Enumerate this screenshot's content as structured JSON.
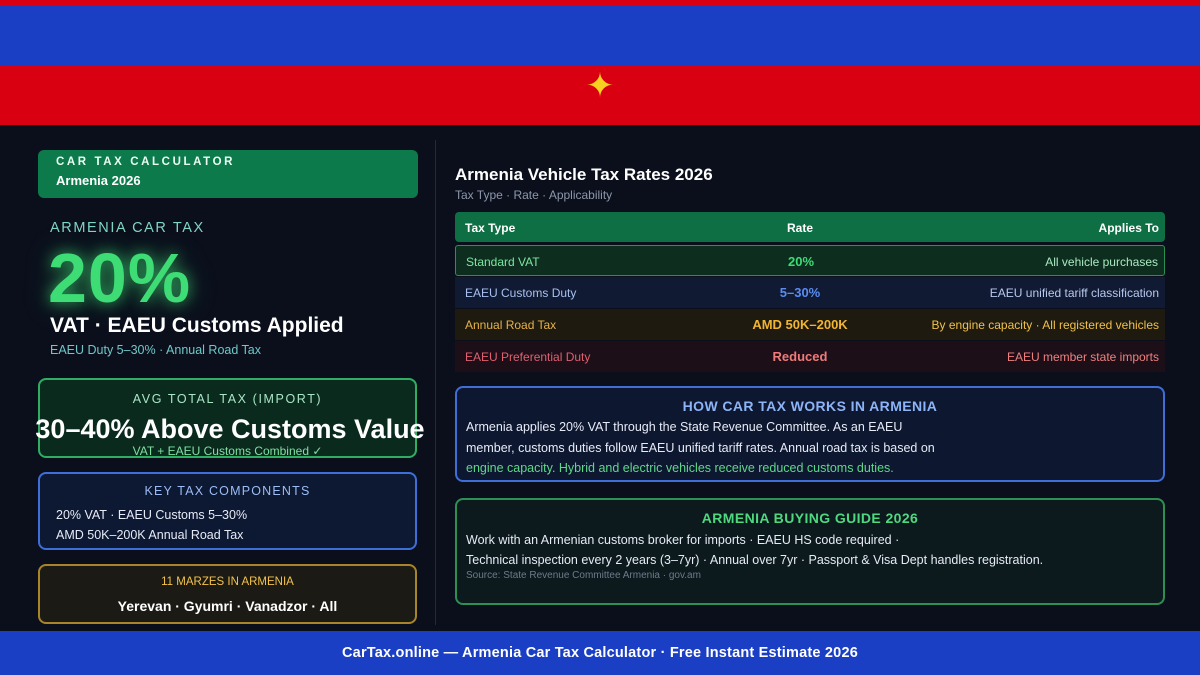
{
  "colors": {
    "flag_red": "#d90012",
    "flag_blue": "#1a3ec4",
    "flag_star": "#f8d020",
    "background": "#0b0f1c",
    "accent_green": "#3ddc74",
    "accent_blue": "#3e6ed8",
    "accent_gold": "#f2b531",
    "accent_red": "#f07a7a"
  },
  "flag": {
    "star_icon": "four-point-star-icon",
    "star_glyph": "✦"
  },
  "badge": {
    "title": "CAR TAX CALCULATOR",
    "subtitle": "Armenia 2026"
  },
  "hero": {
    "label": "ARMENIA CAR TAX",
    "rate": "20%",
    "headline": "VAT · EAEU Customs Applied",
    "sub": "EAEU Duty 5–30% · Annual Road Tax"
  },
  "avg_tax": {
    "label": "AVG TOTAL TAX (IMPORT)",
    "value": "30–40% Above Customs Value",
    "note": "VAT + EAEU Customs Combined ✓"
  },
  "key_components": {
    "label": "KEY TAX COMPONENTS",
    "line1": "20% VAT · EAEU Customs 5–30%",
    "line2": "AMD 50K–200K Annual Road Tax"
  },
  "marzes": {
    "label": "11 MARZES IN ARMENIA",
    "cities": "Yerevan · Gyumri · Vanadzor · All"
  },
  "rates": {
    "title": "Armenia Vehicle Tax Rates 2026",
    "subtitle": "Tax Type · Rate · Applicability",
    "headers": [
      "Tax Type",
      "Rate",
      "Applies To"
    ],
    "rows": [
      {
        "type": "Standard VAT",
        "rate": "20%",
        "applies": "All vehicle purchases"
      },
      {
        "type": "EAEU Customs Duty",
        "rate": "5–30%",
        "applies": "EAEU unified tariff classification"
      },
      {
        "type": "Annual Road Tax",
        "rate": "AMD 50K–200K",
        "applies": "By engine capacity · All registered vehicles"
      },
      {
        "type": "EAEU Preferential Duty",
        "rate": "Reduced",
        "applies": "EAEU member state imports"
      }
    ]
  },
  "how": {
    "title": "HOW CAR TAX WORKS IN ARMENIA",
    "line1": "Armenia applies 20% VAT through the State Revenue Committee. As an EAEU",
    "line2": "member, customs duties follow EAEU unified tariff rates. Annual road tax is based on",
    "line3": "engine capacity. Hybrid and electric vehicles receive reduced customs duties."
  },
  "guide": {
    "title": "ARMENIA BUYING GUIDE 2026",
    "line1": "Work with an Armenian customs broker for imports · EAEU HS code required ·",
    "line2": "Technical inspection every 2 years (3–7yr) · Annual over 7yr · Passport & Visa Dept handles registration.",
    "source": "Source: State Revenue Committee Armenia · gov.am"
  },
  "footer": {
    "text": "CarTax.online — Armenia Car Tax Calculator · Free Instant Estimate 2026"
  }
}
